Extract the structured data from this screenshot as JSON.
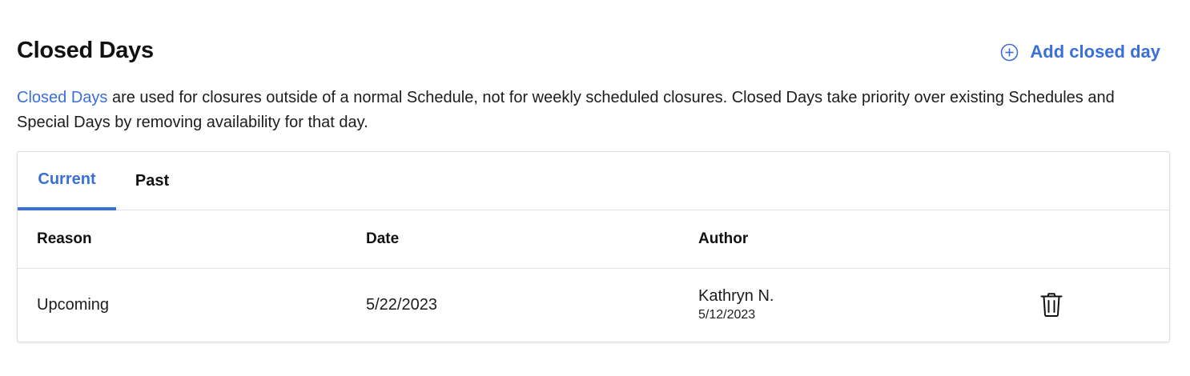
{
  "header": {
    "title": "Closed Days",
    "add_label": "Add closed day",
    "add_icon": "plus-circle-icon"
  },
  "description": {
    "link_text": "Closed Days",
    "text": " are used for closures outside of a normal Schedule, not for weekly scheduled closures. Closed Days take priority over existing Schedules and Special Days by removing availability for that day."
  },
  "tabs": [
    {
      "label": "Current",
      "active": true
    },
    {
      "label": "Past",
      "active": false
    }
  ],
  "table": {
    "columns": [
      "Reason",
      "Date",
      "Author"
    ],
    "rows": [
      {
        "reason": "Upcoming",
        "date": "5/22/2023",
        "author": "Kathryn N.",
        "author_date": "5/12/2023",
        "action_icon": "trash-icon"
      }
    ]
  },
  "colors": {
    "accent": "#3a6fd8",
    "text": "#111111",
    "border": "#dcdcdc"
  }
}
